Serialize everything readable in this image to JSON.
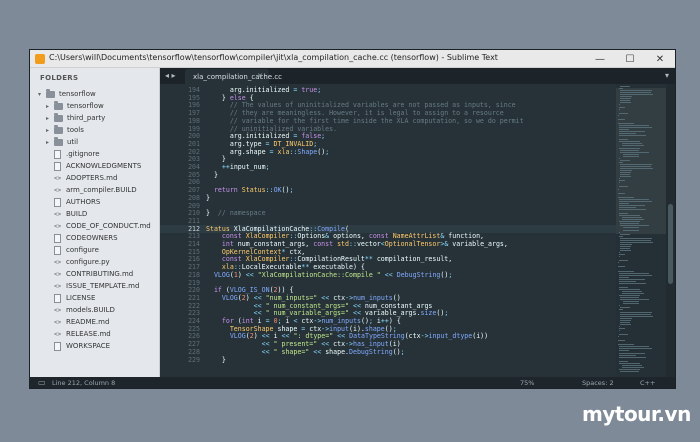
{
  "window": {
    "title": "C:\\Users\\will\\Documents\\tensorflow\\tensorflow\\compiler\\jit\\xla_compilation_cache.cc (tensorflow) - Sublime Text",
    "controls": [
      "—",
      "☐",
      "✕"
    ]
  },
  "sidebar": {
    "header": "FOLDERS",
    "root": "tensorflow",
    "folders": [
      "tensorflow",
      "third_party",
      "tools",
      "util"
    ],
    "files": [
      {
        "name": ".gitignore",
        "icon": "file-icon"
      },
      {
        "name": "ACKNOWLEDGMENTS",
        "icon": "file-icon"
      },
      {
        "name": "ADOPTERS.md",
        "icon": "code-icon"
      },
      {
        "name": "arm_compiler.BUILD",
        "icon": "code-icon"
      },
      {
        "name": "AUTHORS",
        "icon": "file-icon"
      },
      {
        "name": "BUILD",
        "icon": "code-icon"
      },
      {
        "name": "CODE_OF_CONDUCT.md",
        "icon": "code-icon"
      },
      {
        "name": "CODEOWNERS",
        "icon": "file-icon"
      },
      {
        "name": "configure",
        "icon": "file-icon"
      },
      {
        "name": "configure.py",
        "icon": "code-icon"
      },
      {
        "name": "CONTRIBUTING.md",
        "icon": "code-icon"
      },
      {
        "name": "ISSUE_TEMPLATE.md",
        "icon": "code-icon"
      },
      {
        "name": "LICENSE",
        "icon": "file-icon"
      },
      {
        "name": "models.BUILD",
        "icon": "code-icon"
      },
      {
        "name": "README.md",
        "icon": "code-icon"
      },
      {
        "name": "RELEASE.md",
        "icon": "code-icon"
      },
      {
        "name": "WORKSPACE",
        "icon": "file-icon"
      }
    ]
  },
  "tabs": {
    "nav": "◂ ▸",
    "active": "xla_compilation_cache.cc",
    "close": "✕",
    "dropdown": "▾"
  },
  "editor": {
    "current_line": 212,
    "lines": [
      {
        "n": "194",
        "code": "      arg.initialized = true;"
      },
      {
        "n": "195",
        "code": "    } else {"
      },
      {
        "n": "196",
        "code": "      // The values of uninitialized variables are not passed as inputs, since"
      },
      {
        "n": "197",
        "code": "      // they are meaningless. However, it is legal to assign to a resource"
      },
      {
        "n": "198",
        "code": "      // variable for the first time inside the XLA computation, so we do permit"
      },
      {
        "n": "199",
        "code": "      // uninitialized variables."
      },
      {
        "n": "200",
        "code": "      arg.initialized = false;"
      },
      {
        "n": "201",
        "code": "      arg.type = DT_INVALID;"
      },
      {
        "n": "202",
        "code": "      arg.shape = xla::Shape();"
      },
      {
        "n": "203",
        "code": "    }"
      },
      {
        "n": "204",
        "code": "    ++input_num;"
      },
      {
        "n": "205",
        "code": "  }"
      },
      {
        "n": "206",
        "code": ""
      },
      {
        "n": "207",
        "code": "  return Status::OK();"
      },
      {
        "n": "208",
        "code": "}"
      },
      {
        "n": "209",
        "code": ""
      },
      {
        "n": "210",
        "code": "}  // namespace"
      },
      {
        "n": "211",
        "code": ""
      },
      {
        "n": "212",
        "code": "Status XlaCompilationCache::Compile("
      },
      {
        "n": "213",
        "code": "    const XlaCompiler::Options& options, const NameAttrList& function,"
      },
      {
        "n": "214",
        "code": "    int num_constant_args, const std::vector<OptionalTensor>& variable_args,"
      },
      {
        "n": "215",
        "code": "    OpKernelContext* ctx,"
      },
      {
        "n": "216",
        "code": "    const XlaCompiler::CompilationResult** compilation_result,"
      },
      {
        "n": "217",
        "code": "    xla::LocalExecutable** executable) {"
      },
      {
        "n": "218",
        "code": "  VLOG(1) << \"XlaCompilationCache::Compile \" << DebugString();"
      },
      {
        "n": "219",
        "code": ""
      },
      {
        "n": "220",
        "code": "  if (VLOG_IS_ON(2)) {"
      },
      {
        "n": "221",
        "code": "    VLOG(2) << \"num_inputs=\" << ctx->num_inputs()"
      },
      {
        "n": "222",
        "code": "            << \" num_constant_args=\" << num_constant_args"
      },
      {
        "n": "223",
        "code": "            << \" num_variable_args=\" << variable_args.size();"
      },
      {
        "n": "224",
        "code": "    for (int i = 0; i < ctx->num_inputs(); i++) {"
      },
      {
        "n": "225",
        "code": "      TensorShape shape = ctx->input(i).shape();"
      },
      {
        "n": "226",
        "code": "      VLOG(2) << i << \": dtype=\" << DataTypeString(ctx->input_dtype(i))"
      },
      {
        "n": "227",
        "code": "              << \" present=\" << ctx->has_input(i)"
      },
      {
        "n": "228",
        "code": "              << \" shape=\" << shape.DebugString();"
      },
      {
        "n": "229",
        "code": "    }"
      }
    ]
  },
  "statusbar": {
    "position": "Line 212, Column 8",
    "zoom": "75%",
    "indent": "Spaces: 2",
    "syntax": "C++"
  },
  "watermark": "mytour.vn"
}
